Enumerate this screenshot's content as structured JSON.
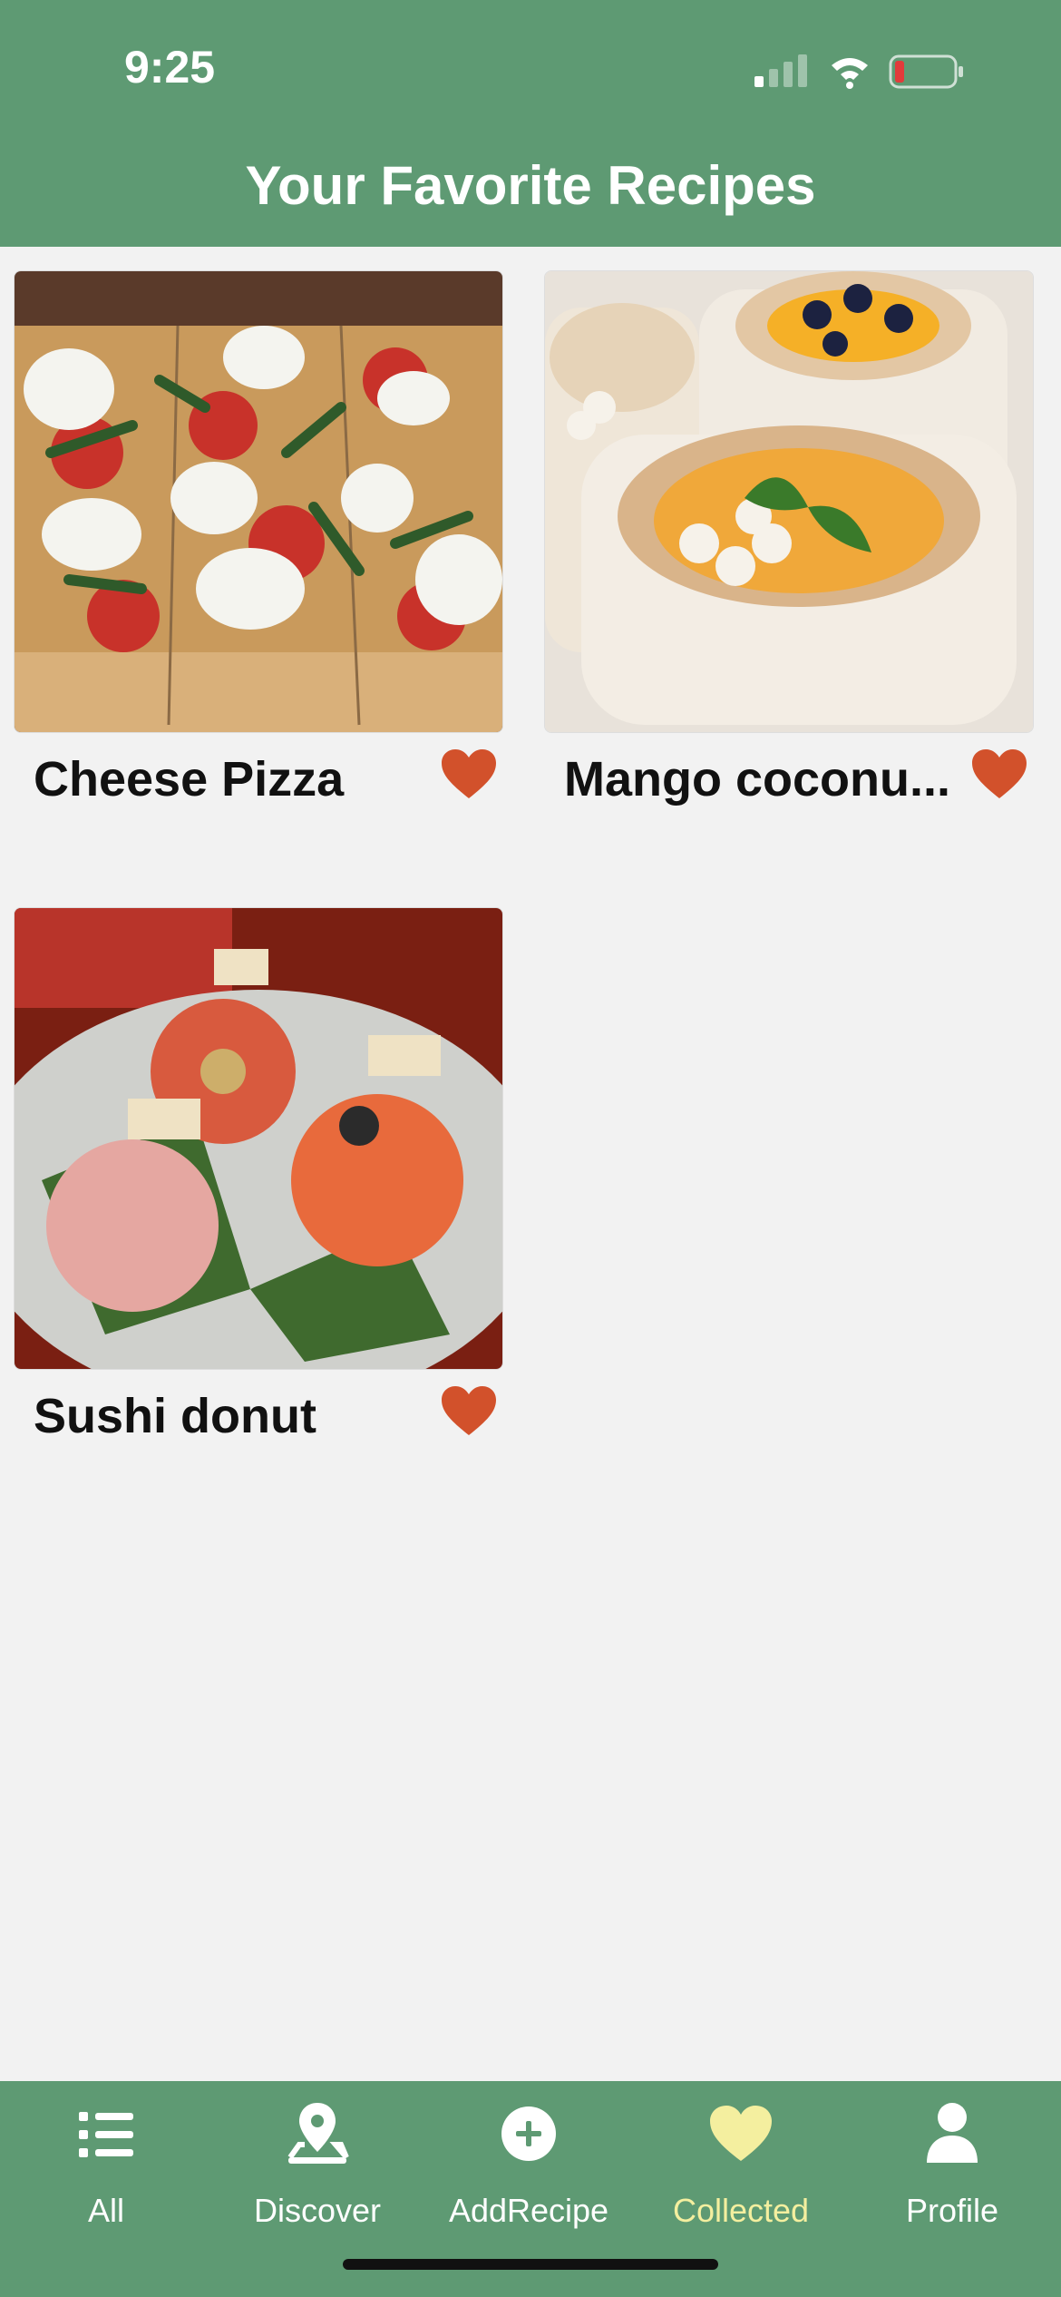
{
  "status": {
    "time": "9:25"
  },
  "header": {
    "title": "Your Favorite Recipes"
  },
  "recipes": [
    {
      "name": "Cheese Pizza",
      "favorited": true
    },
    {
      "name": "Mango coconu...",
      "favorited": true
    },
    {
      "name": "Sushi donut",
      "favorited": true
    }
  ],
  "tabs": [
    {
      "label": "All",
      "icon": "list-icon"
    },
    {
      "label": "Discover",
      "icon": "map-pin-icon"
    },
    {
      "label": "AddRecipe",
      "icon": "plus-circle-icon"
    },
    {
      "label": "Collected",
      "icon": "heart-icon",
      "active": true
    },
    {
      "label": "Profile",
      "icon": "person-icon"
    }
  ],
  "colors": {
    "bar": "#5e9a73",
    "heart": "#d2512b",
    "active_tab": "#f4ef9f",
    "background": "#f2f2f2"
  }
}
